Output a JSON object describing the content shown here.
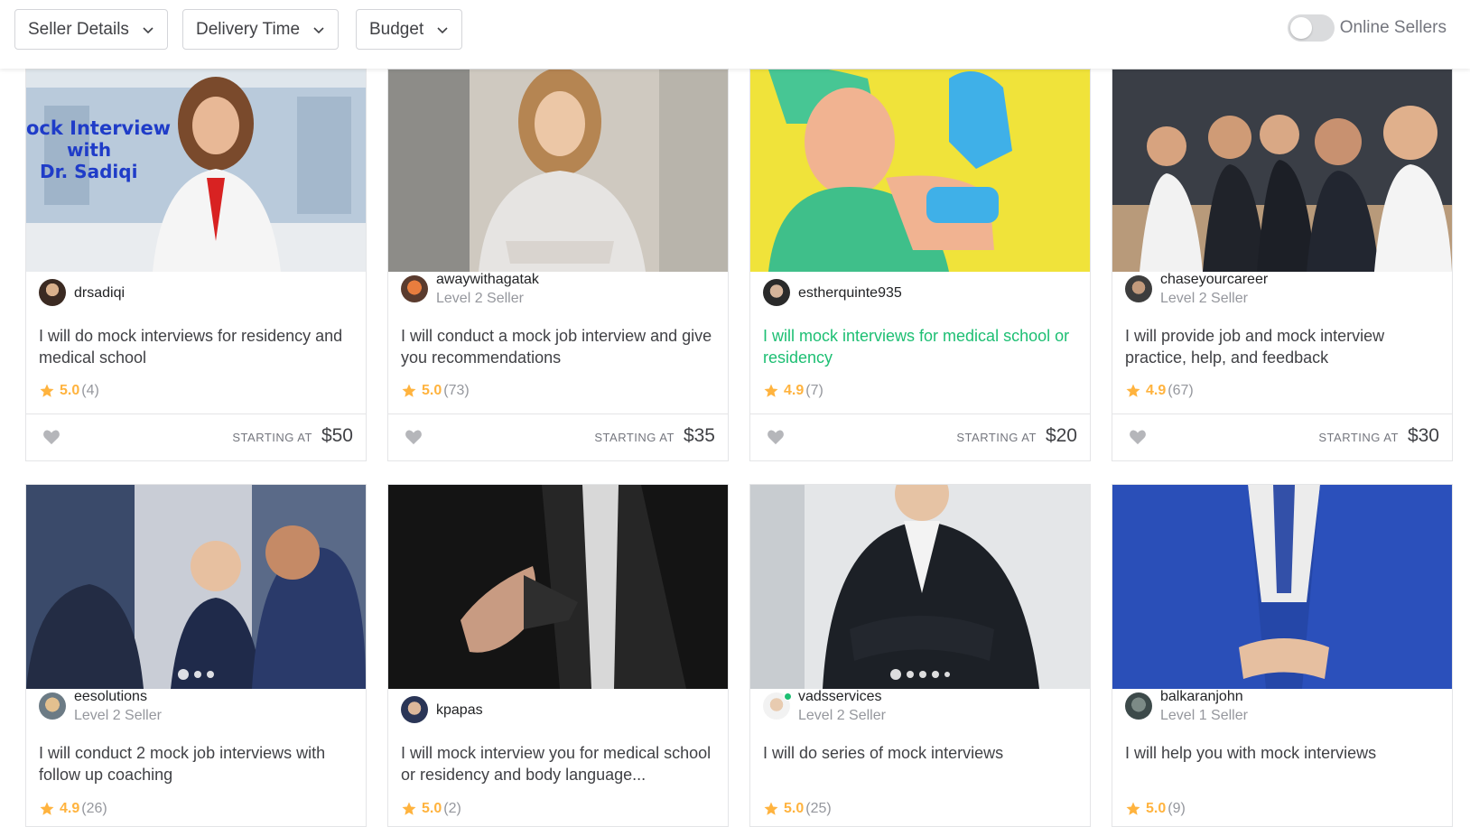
{
  "filters": {
    "seller_details": "Seller Details",
    "delivery_time": "Delivery Time",
    "budget": "Budget",
    "online_sellers": "Online Sellers"
  },
  "starting_at": "STARTING AT",
  "gigs": [
    {
      "seller": "drsadiqi",
      "level": "",
      "title": "I will do mock interviews for residency and medical school",
      "rating": "5.0",
      "count": "(4)",
      "price": "$50",
      "overlay": "ock Interview\nwith\nDr. Sadiqi"
    },
    {
      "seller": "awaywithagatak",
      "level": "Level 2 Seller",
      "title": "I will conduct a mock job interview and give you recommendations",
      "rating": "5.0",
      "count": "(73)",
      "price": "$35"
    },
    {
      "seller": "estherquinte935",
      "level": "",
      "title": "I will mock interviews for medical school or residency",
      "rating": "4.9",
      "count": "(7)",
      "price": "$20"
    },
    {
      "seller": "chaseyourcareer",
      "level": "Level 2 Seller",
      "title": "I will provide job and mock interview practice, help, and feedback",
      "rating": "4.9",
      "count": "(67)",
      "price": "$30"
    },
    {
      "seller": "eesolutions",
      "level": "Level 2 Seller",
      "title": "I will conduct 2 mock job interviews with follow up coaching",
      "rating": "4.9",
      "count": "(26)",
      "price": ""
    },
    {
      "seller": "kpapas",
      "level": "",
      "title": "I will mock interview you for medical school or residency and body language...",
      "rating": "5.0",
      "count": "(2)",
      "price": ""
    },
    {
      "seller": "vadsservices",
      "level": "Level 2 Seller",
      "title": "I will do series of mock interviews",
      "rating": "5.0",
      "count": "(25)",
      "price": ""
    },
    {
      "seller": "balkaranjohn",
      "level": "Level 1 Seller",
      "title": "I will help you with mock interviews",
      "rating": "5.0",
      "count": "(9)",
      "price": ""
    }
  ],
  "colors": {
    "accent_green": "#1dbf73",
    "star": "#ffb33e"
  }
}
